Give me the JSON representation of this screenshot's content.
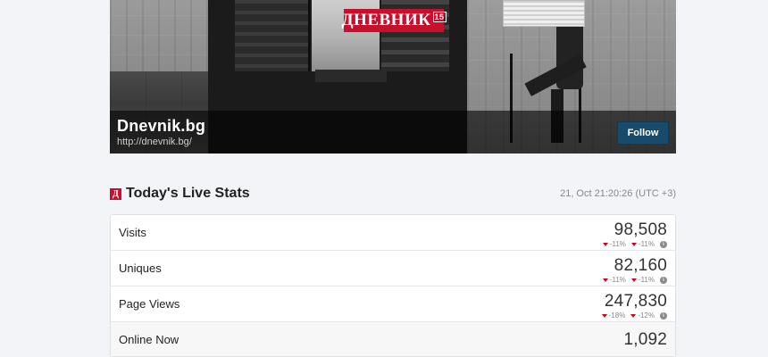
{
  "banner": {
    "logo_text": "ДНЕВНИК",
    "logo_badge": "15",
    "site_name": "Dnevnik.bg",
    "site_url": "http://dnevnik.bg/",
    "follow_label": "Follow"
  },
  "stats": {
    "brand_icon": "Д",
    "title": "Today's Live Stats",
    "timestamp": "21, Oct 21:20:26 (UTC +3)",
    "rows": [
      {
        "label": "Visits",
        "value": "98,508",
        "delta1": "-11%",
        "delta2": "-11%"
      },
      {
        "label": "Uniques",
        "value": "82,160",
        "delta1": "-11%",
        "delta2": "-11%"
      },
      {
        "label": "Page Views",
        "value": "247,830",
        "delta1": "-18%",
        "delta2": "-12%"
      },
      {
        "label": "Online Now",
        "value": "1,092"
      }
    ]
  },
  "icons": {
    "delta_arrow": "arrow-down-icon",
    "info": "info-icon"
  },
  "colors": {
    "brand_red": "#c8102e",
    "follow_button": "#174a6b",
    "delta_down": "#d0021b"
  }
}
